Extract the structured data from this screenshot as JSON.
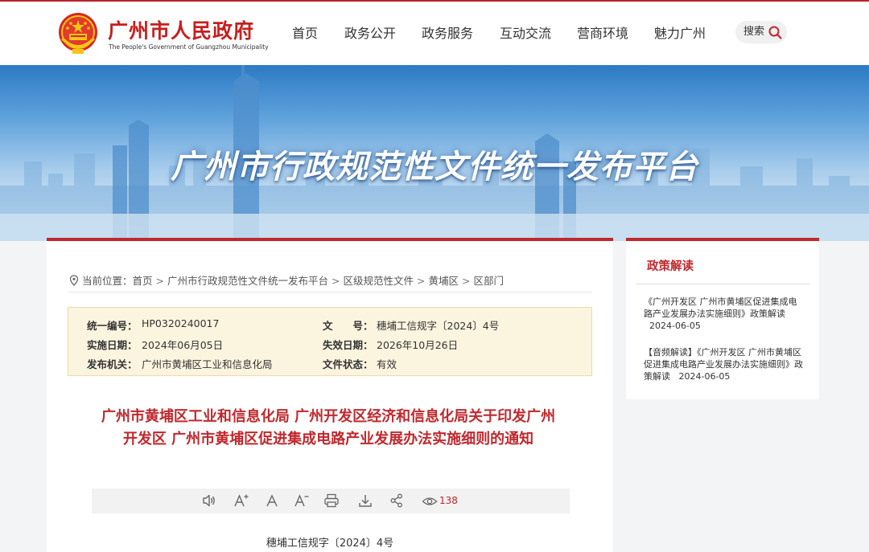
{
  "header": {
    "site_name": "广州市人民政府",
    "site_name_en": "The People's Government of Guangzhou Municipality",
    "nav": [
      "首页",
      "政务公开",
      "政务服务",
      "互动交流",
      "营商环境",
      "魅力广州"
    ],
    "search_label": "搜索"
  },
  "banner": {
    "title": "广州市行政规范性文件统一发布平台"
  },
  "breadcrumb": {
    "label": "当前位置：",
    "items": [
      "首页",
      "广州市行政规范性文件统一发布平台",
      "区级规范性文件",
      "黄埔区",
      "区部门"
    ]
  },
  "meta": {
    "serial_label": "统一编号：",
    "serial_value": "HP0320240017",
    "docno_label": "文　　号：",
    "docno_value": "穗埔工信规字〔2024〕4号",
    "effective_label": "实施日期：",
    "effective_value": "2024年06月05日",
    "expire_label": "失效日期：",
    "expire_value": "2026年10月26日",
    "issuer_label": "发布机关：",
    "issuer_value": "广州市黄埔区工业和信息化局",
    "status_label": "文件状态：",
    "status_value": "有效"
  },
  "document": {
    "title": "广州市黄埔区工业和信息化局 广州开发区经济和信息化局关于印发广州开发区 广州市黄埔区促进集成电路产业发展办法实施细则的通知",
    "number": "穗埔工信规字〔2024〕4号"
  },
  "toolbar": {
    "views": "138"
  },
  "sidebar": {
    "title": "政策解读",
    "items": [
      {
        "text": "《广州开发区 广州市黄埔区促进集成电路产业发展办法实施细则》政策解读",
        "date": "2024-06-05"
      },
      {
        "text": "【音频解读】《广州开发区 广州市黄埔区促进集成电路产业发展办法实施细则》政策解读",
        "date": "2024-06-05"
      }
    ]
  },
  "colors": {
    "brand_red": "#c0282d",
    "meta_bg": "#fbf4df",
    "banner_blue": "#5fa2dc"
  }
}
